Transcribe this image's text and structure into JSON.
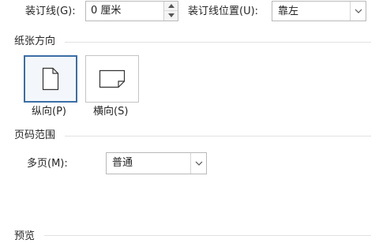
{
  "gutter": {
    "label": "装订线(G):",
    "value": "0 厘米",
    "position_label": "装订线位置(U):",
    "position_value": "靠左"
  },
  "orientation": {
    "title": "纸张方向",
    "portrait_label": "纵向(P)",
    "landscape_label": "横向(S)",
    "selected": "portrait"
  },
  "pages": {
    "title": "页码范围",
    "multiple_label": "多页(M):",
    "multiple_value": "普通"
  },
  "preview": {
    "title": "预览"
  },
  "colors": {
    "selected_border": "#3b6ea5",
    "field_border": "#b9b9b9",
    "rule": "#e2e2e2"
  }
}
